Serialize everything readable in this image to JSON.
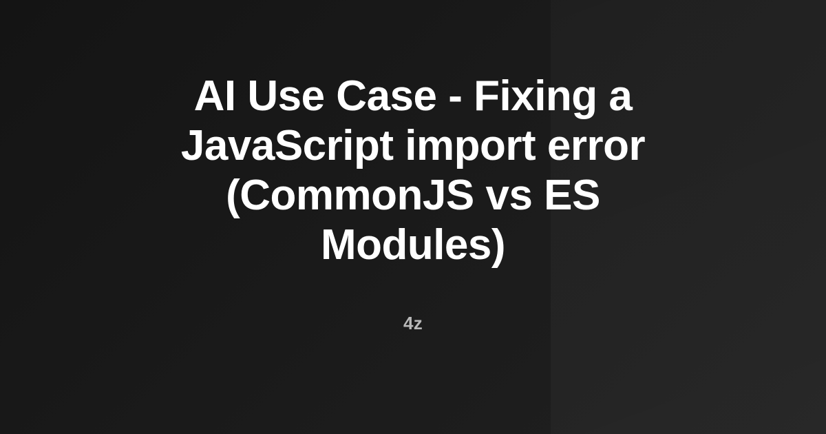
{
  "card": {
    "title": "AI Use Case - Fixing a\nJavaScript import error\n(CommonJS vs ES\nModules)",
    "author": "4z"
  },
  "colors": {
    "background": "#161616",
    "title_text": "#ffffff",
    "author_text": "#b9b9b9"
  }
}
